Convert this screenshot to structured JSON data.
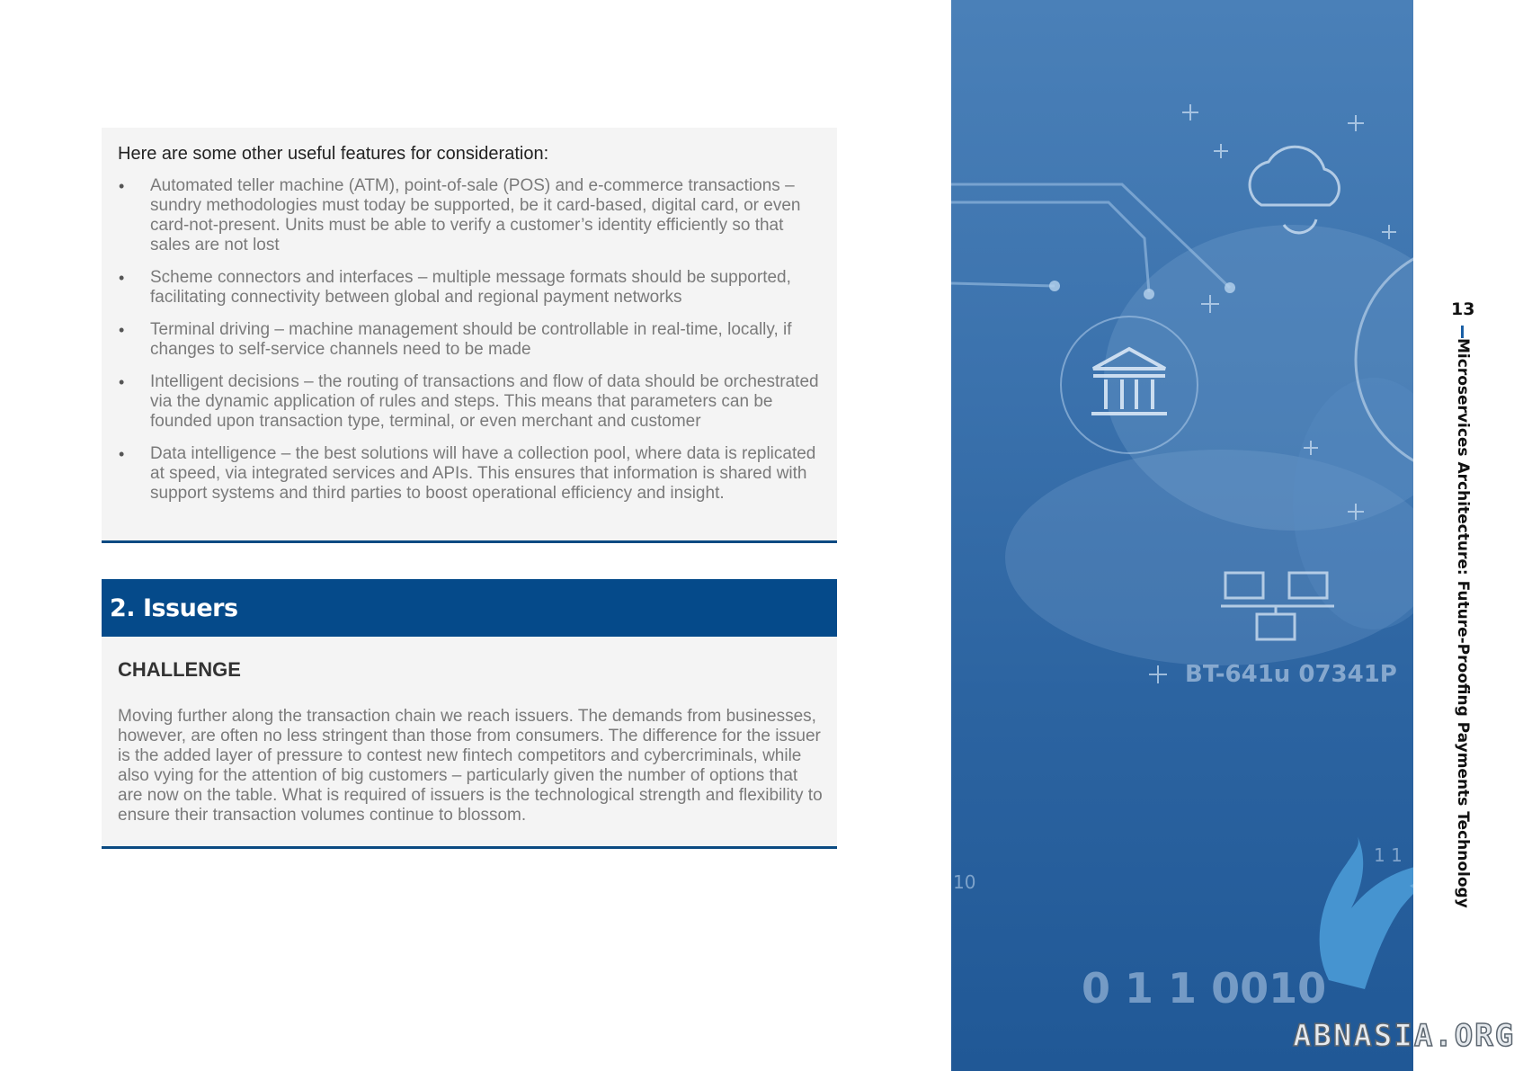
{
  "features": {
    "intro": "Here are some other useful features for consideration:",
    "items": [
      "Automated teller machine (ATM), point-of-sale (POS) and e-commerce transactions – sundry methodologies must today be supported, be it card-based, digital card, or even card-not-present. Units must be able to verify a customer’s identity efficiently so that sales are not lost",
      "Scheme connectors and interfaces – multiple message formats should be supported, facilitating connectivity between global and regional payment networks",
      "Terminal driving – machine management should be controllable in real-time, locally, if changes to self-service channels need to be made",
      "Intelligent decisions – the routing of transactions and flow of data should be orchestrated via the dynamic application of rules and steps. This means that parameters can be founded upon transaction type, terminal, or even merchant and customer",
      "Data intelligence – the best solutions will have a collection pool, where data is replicated at speed, via integrated services and APIs. This ensures that information is shared with support systems and third parties to boost operational efficiency and insight."
    ]
  },
  "section": {
    "title": "2. Issuers"
  },
  "challenge": {
    "heading": "CHALLENGE",
    "text": "Moving further along the transaction chain we reach issuers. The demands from businesses, however, are often no less stringent than those from consumers. The difference for the issuer is the added layer of pressure to contest new fintech competitors and cybercriminals, while also vying for the attention of big customers – particularly given the number of options that are now on the table. What is required of issuers is the technological strength and flexibility to ensure their transaction volumes continue to blossom."
  },
  "image_overlay": {
    "code_text": "BT-641u 07341P",
    "binary_text": "0 1 1  0010",
    "small_text_left": "10",
    "small_text_right": "1 1"
  },
  "sidebar": {
    "page_number": "13",
    "running_title": "Microservices Architecture: Future-Proofing Payments Technology"
  },
  "watermark": {
    "text": "ABNASIA.ORG"
  },
  "colors": {
    "accent_blue": "#054a8a",
    "panel_background": "#f4f4f4",
    "body_text": "#7a7a7a"
  }
}
